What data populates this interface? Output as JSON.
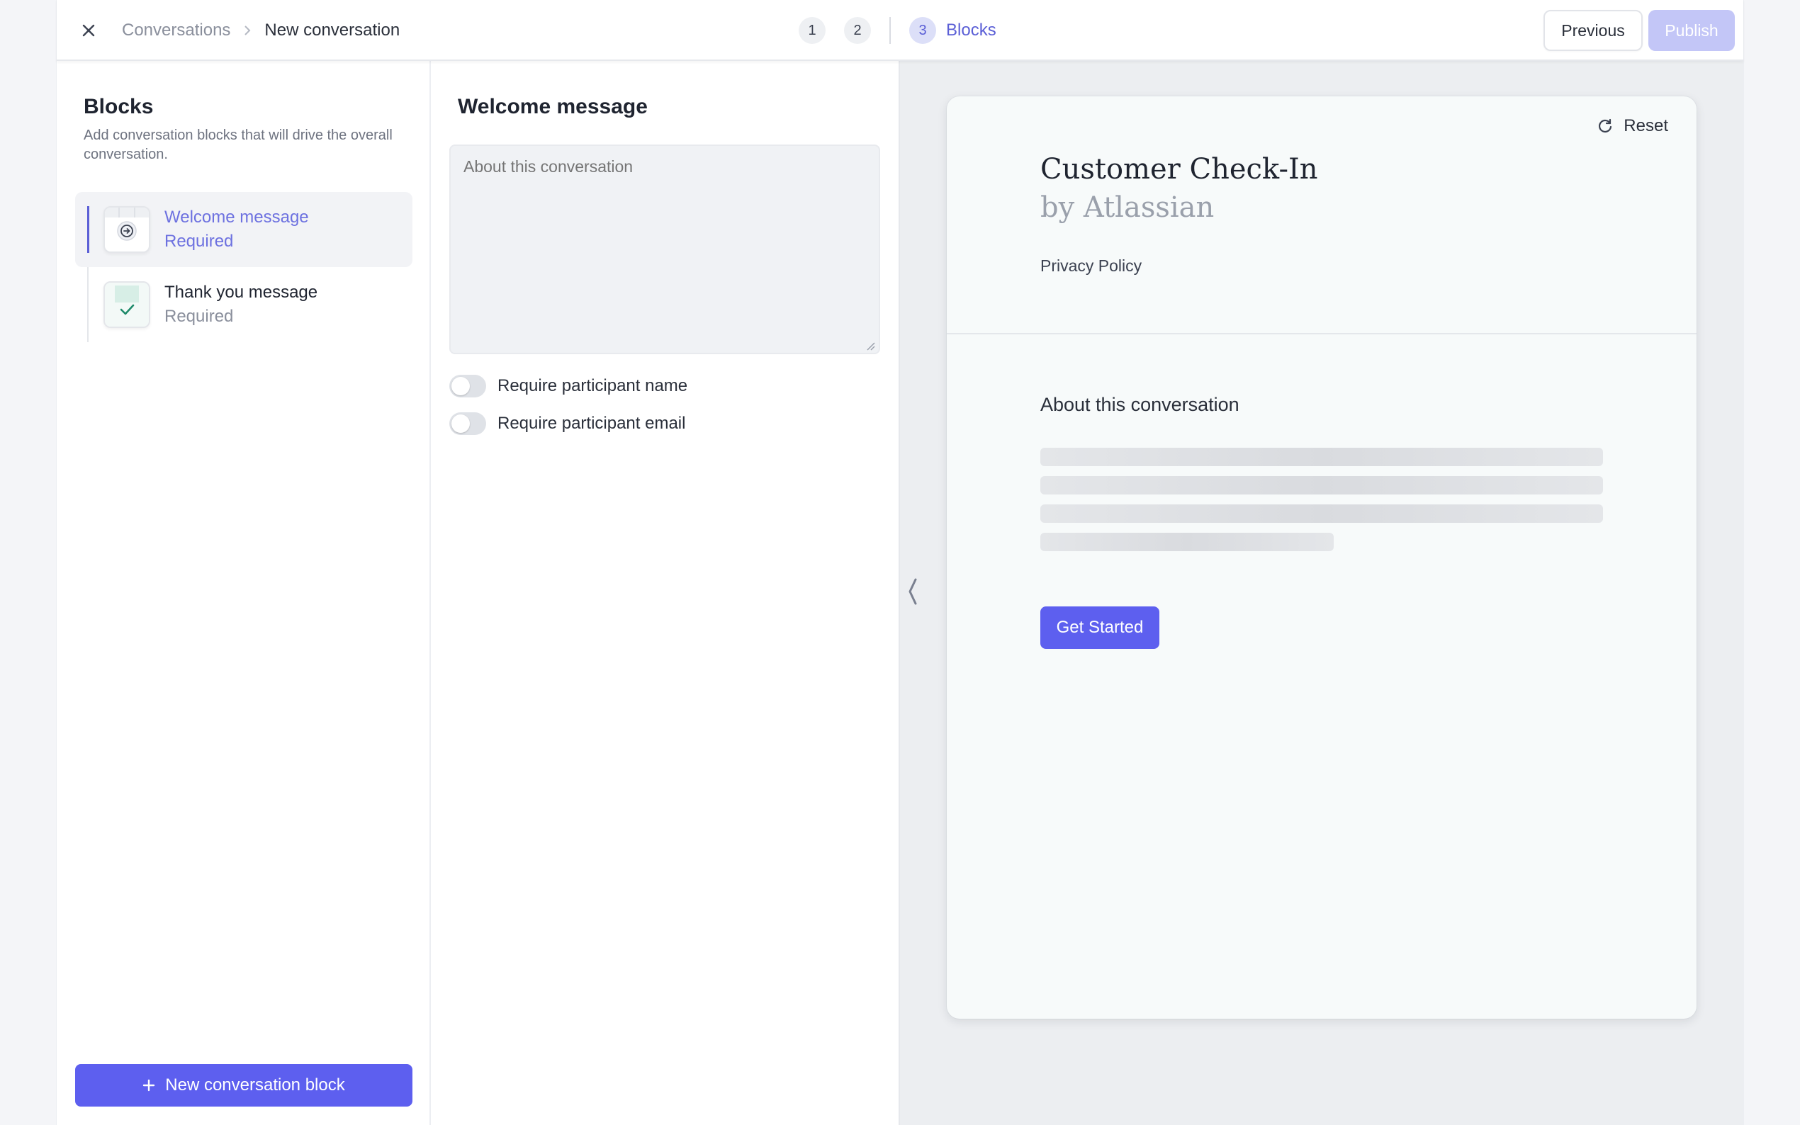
{
  "breadcrumb": {
    "root": "Conversations",
    "current": "New conversation"
  },
  "steps": {
    "step1": "1",
    "step2": "2",
    "step3": "3",
    "active_label": "Blocks"
  },
  "actions": {
    "previous": "Previous",
    "publish": "Publish"
  },
  "blocks_panel": {
    "title": "Blocks",
    "description": "Add conversation blocks that will drive the overall conversation.",
    "items": [
      {
        "label": "Welcome message",
        "sub": "Required",
        "icon": "welcome-icon",
        "active": true
      },
      {
        "label": "Thank you message",
        "sub": "Required",
        "icon": "thank-you-icon",
        "active": false
      }
    ],
    "new_button": "New conversation block"
  },
  "editor": {
    "title": "Welcome message",
    "textarea_placeholder": "About this conversation",
    "toggles": [
      {
        "label": "Require participant name",
        "on": false
      },
      {
        "label": "Require participant email",
        "on": false
      }
    ]
  },
  "preview": {
    "reset": "Reset",
    "title": "Customer Check-In",
    "subtitle": "by Atlassian",
    "privacy": "Privacy Policy",
    "about_heading": "About this conversation",
    "cta": "Get Started"
  },
  "colors": {
    "accent": "#5d5fef",
    "accent_text": "#5b5fd6",
    "publish_disabled": "#c3c6f7"
  }
}
